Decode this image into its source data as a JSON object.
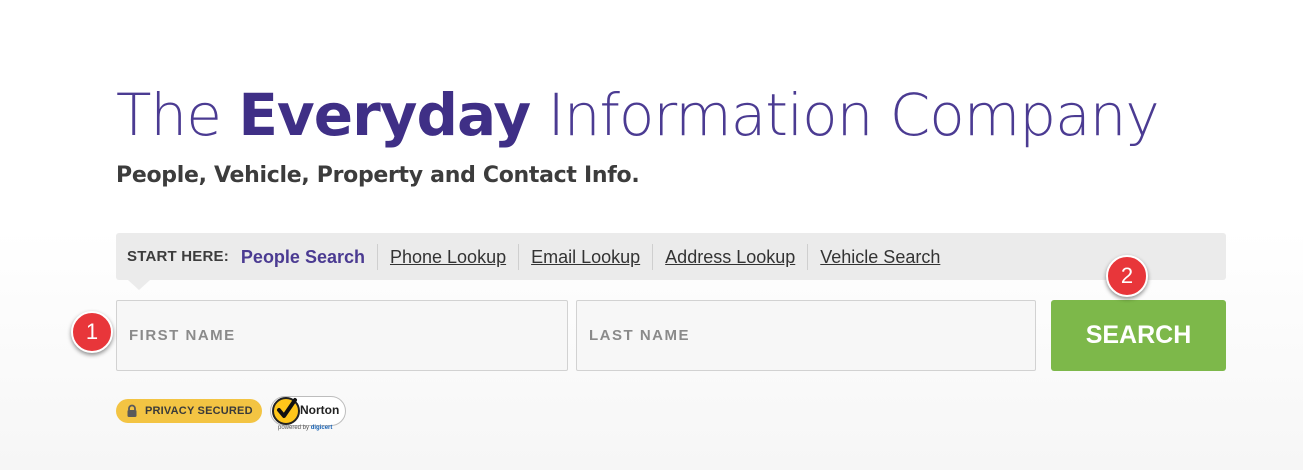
{
  "hero": {
    "headline_prefix": "The ",
    "headline_bold": "Everyday",
    "headline_suffix": " Information Company",
    "subheadline": "People, Vehicle, Property and Contact Info."
  },
  "tabs": {
    "start_label": "START HERE:",
    "items": [
      {
        "label": "People Search",
        "active": true
      },
      {
        "label": "Phone Lookup",
        "active": false
      },
      {
        "label": "Email Lookup",
        "active": false
      },
      {
        "label": "Address Lookup",
        "active": false
      },
      {
        "label": "Vehicle Search",
        "active": false
      }
    ]
  },
  "form": {
    "first_name_placeholder": "FIRST NAME",
    "first_name_value": "",
    "last_name_placeholder": "LAST NAME",
    "last_name_value": "",
    "search_label": "SEARCH"
  },
  "markers": {
    "one": "1",
    "two": "2"
  },
  "trust": {
    "privacy_label": "PRIVACY SECURED",
    "privacy_icon": "lock-icon",
    "norton_label": "Norton",
    "norton_powered": "powered by ",
    "norton_digicert": "digicert"
  },
  "colors": {
    "brand_purple": "#4b3b92",
    "search_green": "#7db84a",
    "marker_red": "#e8363a",
    "privacy_yellow": "#f3c443"
  }
}
